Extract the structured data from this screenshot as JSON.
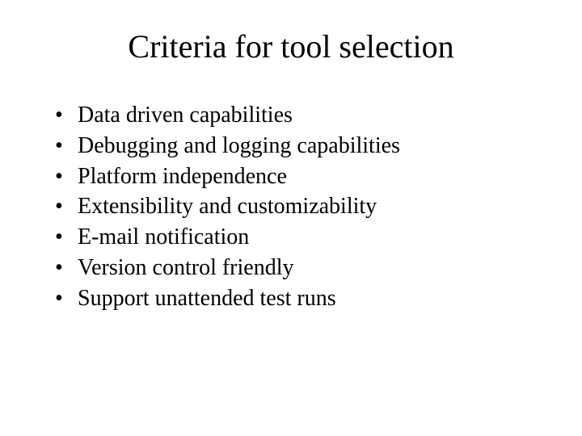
{
  "slide": {
    "title": "Criteria for tool selection",
    "bullets": [
      "Data driven capabilities",
      "Debugging and logging capabilities",
      "Platform independence",
      "Extensibility and customizability",
      "E-mail notification",
      "Version control friendly",
      "Support unattended test runs"
    ]
  }
}
